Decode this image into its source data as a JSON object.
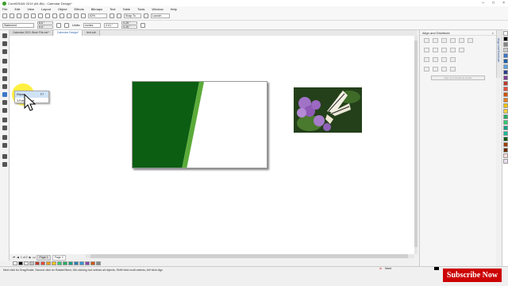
{
  "window": {
    "title": "CorelDRAW 2019 (64-Bit) - Calendar Design*"
  },
  "menu": [
    "File",
    "Edit",
    "View",
    "Layout",
    "Object",
    "Effects",
    "Bitmaps",
    "Text",
    "Table",
    "Tools",
    "Window",
    "Help"
  ],
  "toolbar": {
    "zoom": "62%",
    "snap_to": "Snap To",
    "launch": "Launch"
  },
  "propbar": {
    "preset": "Statement",
    "width": "8.5 \"",
    "height": "5.5 \"",
    "units_label": "Units:",
    "units_value": "inches",
    "nudge": "0.01 \"",
    "dup_x": "0.25 \"",
    "dup_y": "0.25 \""
  },
  "tabs": [
    "Calendar 2021 Work File.cdr*",
    "Calendar Design*",
    "text.cdr"
  ],
  "flyout": {
    "items": [
      {
        "label": "Ellipse",
        "shortcut": "F7"
      },
      {
        "label": "3-Point Ellipse",
        "shortcut": ""
      }
    ]
  },
  "pagenav": {
    "counter": "1 of 2",
    "pages": [
      "Page 1",
      "Page 2"
    ]
  },
  "status": {
    "hint": "Next click for Drag/Scale; Second click for Rotate/Skew; Dbl-clicking tool selects all objects; Shift+click multi-selects; Alt+click digs",
    "fill": "None"
  },
  "right_panel": {
    "title": "Align and Distribute",
    "button": "Align and Distribute Nodes",
    "tab": "Align and Distribute"
  },
  "subscribe": "Subscribe Now",
  "colors": {
    "green": "#0b5e12",
    "light_green": "#5aab3a",
    "accent": "#3366aa"
  },
  "palette_strip": [
    "#ffffff",
    "#000000",
    "#e8e8e8",
    "#c0c0c0",
    "#c0392b",
    "#e74c3c",
    "#f39c12",
    "#f1c40f",
    "#2ecc71",
    "#27ae60",
    "#16a085",
    "#2980b9",
    "#3498db",
    "#8e44ad",
    "#d35400",
    "#7f8c8d"
  ],
  "color_palette": [
    "#ffffff",
    "#000000",
    "#888888",
    "#cccccc",
    "#3a78c9",
    "#1e5fa8",
    "#5aa1e0",
    "#2c3e8c",
    "#7d3c98",
    "#c0392b",
    "#e74c3c",
    "#d35400",
    "#e67e22",
    "#f1c40f",
    "#f4d03f",
    "#27ae60",
    "#2ecc71",
    "#16a085",
    "#1abc9c",
    "#0b5e12",
    "#a04000",
    "#6e2c00",
    "#fadbd8",
    "#ebdef0"
  ]
}
